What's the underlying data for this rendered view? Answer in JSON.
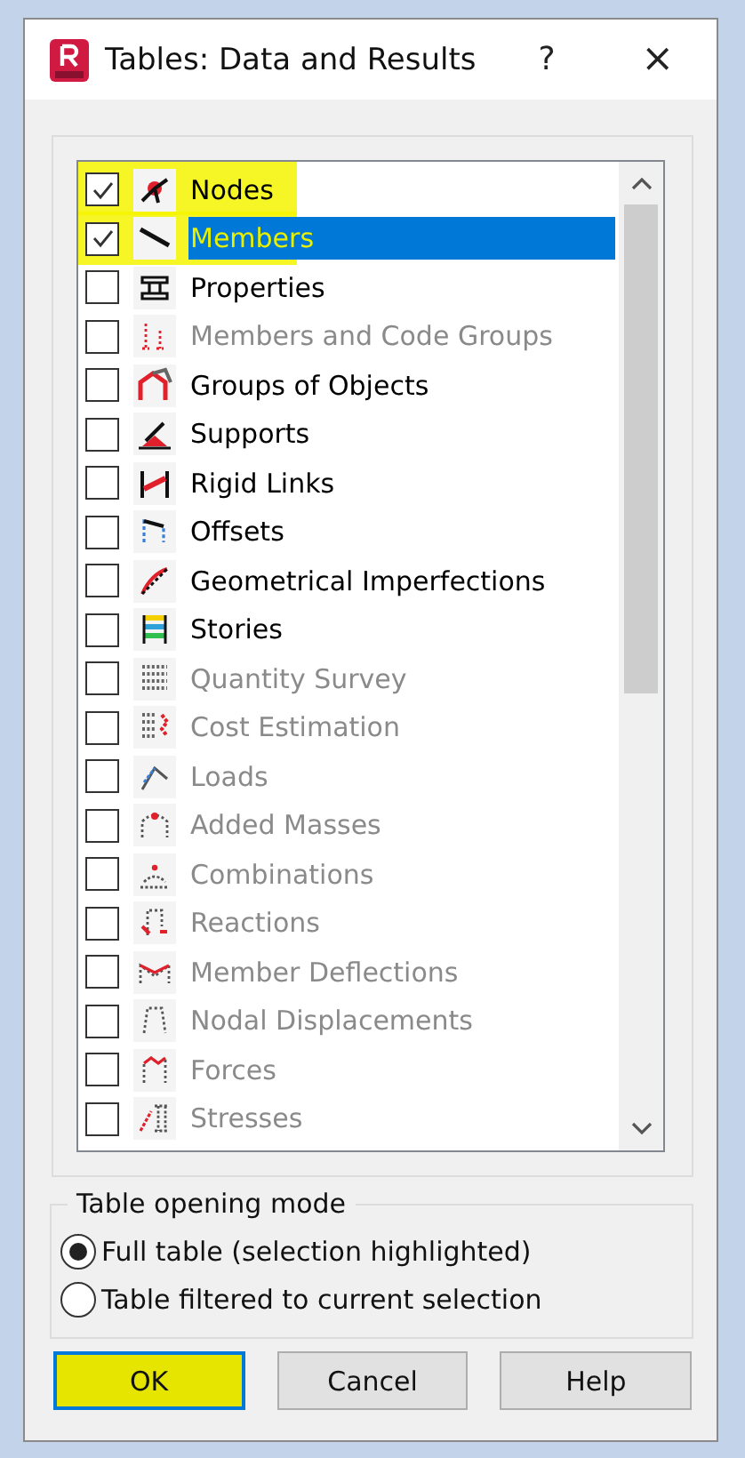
{
  "window": {
    "title": "Tables: Data and Results",
    "help_button": "?",
    "close_button": "×"
  },
  "tables": [
    {
      "label": "Nodes",
      "checked": true,
      "disabled": false,
      "selected": false,
      "highlighted": true
    },
    {
      "label": "Members",
      "checked": true,
      "disabled": false,
      "selected": true,
      "highlighted": true
    },
    {
      "label": "Properties",
      "checked": false,
      "disabled": false,
      "selected": false,
      "highlighted": false
    },
    {
      "label": "Members and Code Groups",
      "checked": false,
      "disabled": true,
      "selected": false,
      "highlighted": false
    },
    {
      "label": "Groups of Objects",
      "checked": false,
      "disabled": false,
      "selected": false,
      "highlighted": false
    },
    {
      "label": "Supports",
      "checked": false,
      "disabled": false,
      "selected": false,
      "highlighted": false
    },
    {
      "label": "Rigid Links",
      "checked": false,
      "disabled": false,
      "selected": false,
      "highlighted": false
    },
    {
      "label": "Offsets",
      "checked": false,
      "disabled": false,
      "selected": false,
      "highlighted": false
    },
    {
      "label": "Geometrical Imperfections",
      "checked": false,
      "disabled": false,
      "selected": false,
      "highlighted": false
    },
    {
      "label": "Stories",
      "checked": false,
      "disabled": false,
      "selected": false,
      "highlighted": false
    },
    {
      "label": "Quantity Survey",
      "checked": false,
      "disabled": true,
      "selected": false,
      "highlighted": false
    },
    {
      "label": "Cost Estimation",
      "checked": false,
      "disabled": true,
      "selected": false,
      "highlighted": false
    },
    {
      "label": "Loads",
      "checked": false,
      "disabled": true,
      "selected": false,
      "highlighted": false
    },
    {
      "label": "Added Masses",
      "checked": false,
      "disabled": true,
      "selected": false,
      "highlighted": false
    },
    {
      "label": "Combinations",
      "checked": false,
      "disabled": true,
      "selected": false,
      "highlighted": false
    },
    {
      "label": "Reactions",
      "checked": false,
      "disabled": true,
      "selected": false,
      "highlighted": false
    },
    {
      "label": "Member Deflections",
      "checked": false,
      "disabled": true,
      "selected": false,
      "highlighted": false
    },
    {
      "label": "Nodal Displacements",
      "checked": false,
      "disabled": true,
      "selected": false,
      "highlighted": false
    },
    {
      "label": "Forces",
      "checked": false,
      "disabled": true,
      "selected": false,
      "highlighted": false
    },
    {
      "label": "Stresses",
      "checked": false,
      "disabled": true,
      "selected": false,
      "highlighted": false
    }
  ],
  "opening_mode": {
    "title": "Table opening mode",
    "options": [
      {
        "label": "Full table (selection highlighted)",
        "selected": true
      },
      {
        "label": "Table filtered to current selection",
        "selected": false
      }
    ]
  },
  "buttons": [
    {
      "label": "OK",
      "default": true,
      "highlighted": true
    },
    {
      "label": "Cancel",
      "default": false,
      "highlighted": false
    },
    {
      "label": "Help",
      "default": false,
      "highlighted": false
    }
  ]
}
